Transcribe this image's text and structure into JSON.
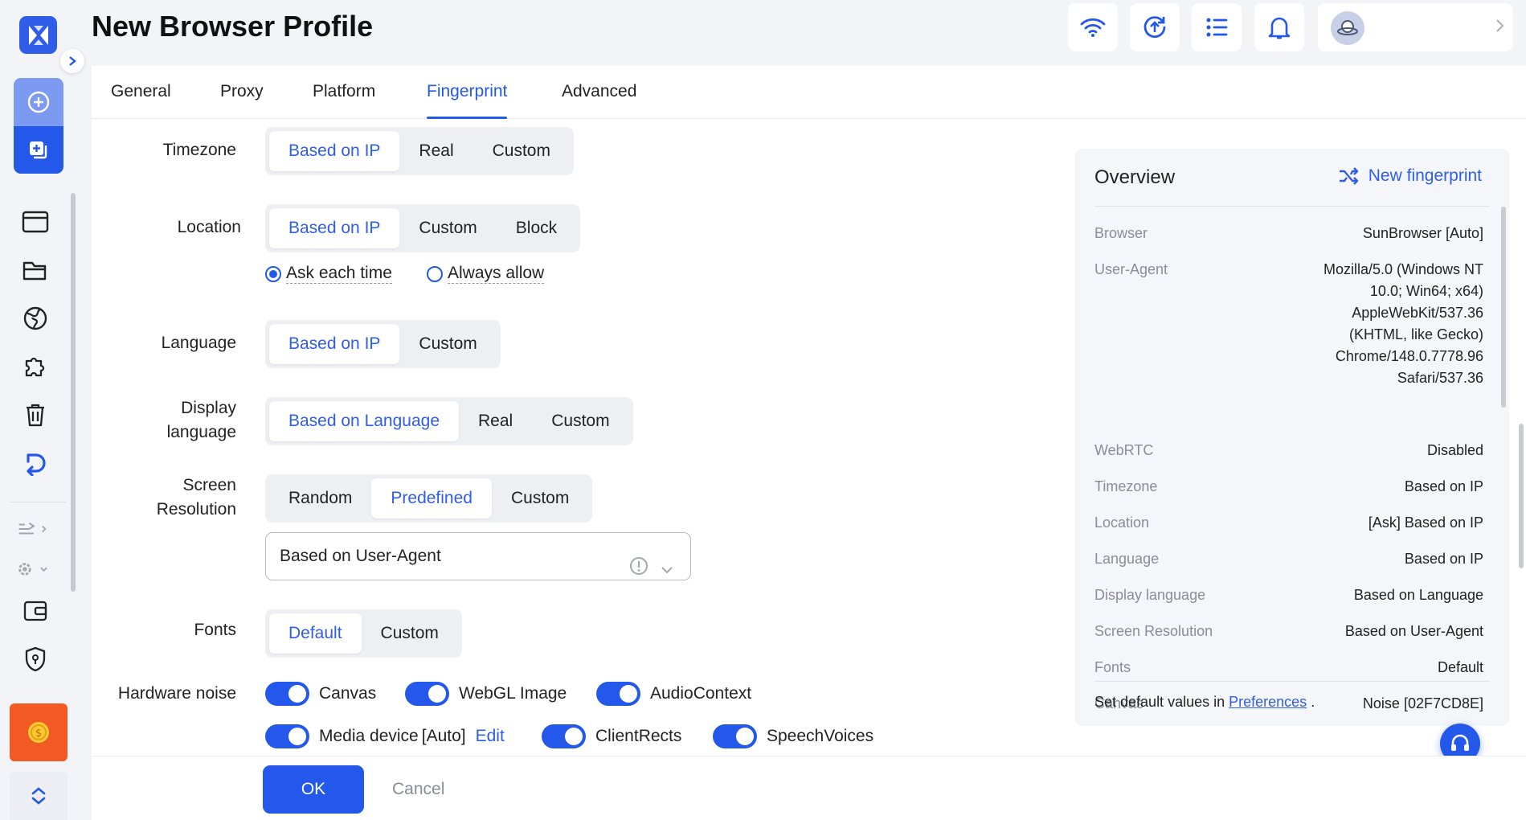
{
  "header": {
    "title": "New Browser Profile"
  },
  "tabs": [
    "General",
    "Proxy",
    "Platform",
    "Fingerprint",
    "Advanced"
  ],
  "active_tab": "Fingerprint",
  "form": {
    "timezone": {
      "label": "Timezone",
      "options": [
        "Based on IP",
        "Real",
        "Custom"
      ],
      "selected": "Based on IP"
    },
    "location": {
      "label": "Location",
      "options": [
        "Based on IP",
        "Custom",
        "Block"
      ],
      "selected": "Based on IP",
      "radios": [
        "Ask each time",
        "Always allow"
      ],
      "radio_selected": "Ask each time"
    },
    "language": {
      "label": "Language",
      "options": [
        "Based on IP",
        "Custom"
      ],
      "selected": "Based on IP"
    },
    "display_language": {
      "label_line1": "Display",
      "label_line2": "language",
      "options": [
        "Based on Language",
        "Real",
        "Custom"
      ],
      "selected": "Based on Language"
    },
    "screen_resolution": {
      "label_line1": "Screen",
      "label_line2": "Resolution",
      "options": [
        "Random",
        "Predefined",
        "Custom"
      ],
      "selected": "Predefined",
      "select_value": "Based on User-Agent"
    },
    "fonts": {
      "label": "Fonts",
      "options": [
        "Default",
        "Custom"
      ],
      "selected": "Default"
    },
    "hardware_noise": {
      "label": "Hardware noise",
      "toggles": [
        {
          "label": "Canvas",
          "on": true
        },
        {
          "label": "WebGL Image",
          "on": true
        },
        {
          "label": "AudioContext",
          "on": true
        },
        {
          "label": "Media device",
          "suffix": "[Auto]",
          "on": true
        },
        {
          "label": "ClientRects",
          "on": true
        },
        {
          "label": "SpeechVoices",
          "on": true
        }
      ],
      "edit_label": "Edit"
    }
  },
  "overview": {
    "title": "Overview",
    "new_fingerprint": "New fingerprint",
    "rows": [
      {
        "key": "Browser",
        "value": [
          "SunBrowser [Auto]"
        ]
      },
      {
        "key": "User-Agent",
        "value": [
          "Mozilla/5.0 (Windows NT",
          "10.0; Win64; x64)",
          "AppleWebKit/537.36",
          "(KHTML, like Gecko)",
          "Chrome/148.0.7778.96",
          "Safari/537.36"
        ]
      },
      {
        "key": "WebRTC",
        "value": [
          "Disabled"
        ]
      },
      {
        "key": "Timezone",
        "value": [
          "Based on IP"
        ]
      },
      {
        "key": "Location",
        "value": [
          "[Ask] Based on IP"
        ]
      },
      {
        "key": "Language",
        "value": [
          "Based on IP"
        ]
      },
      {
        "key": "Display language",
        "value": [
          "Based on Language"
        ]
      },
      {
        "key": "Screen Resolution",
        "value": [
          "Based on User-Agent"
        ]
      },
      {
        "key": "Fonts",
        "value": [
          "Default"
        ]
      },
      {
        "key": "Canvas",
        "value": [
          "Noise [02F7CD8E]"
        ]
      }
    ],
    "footer_prefix": "Set default values in",
    "footer_link": "Preferences",
    "footer_suffix": "."
  },
  "footer": {
    "ok": "OK",
    "cancel": "Cancel"
  },
  "colors": {
    "accent": "#2358ea",
    "promo": "#f15a22"
  }
}
